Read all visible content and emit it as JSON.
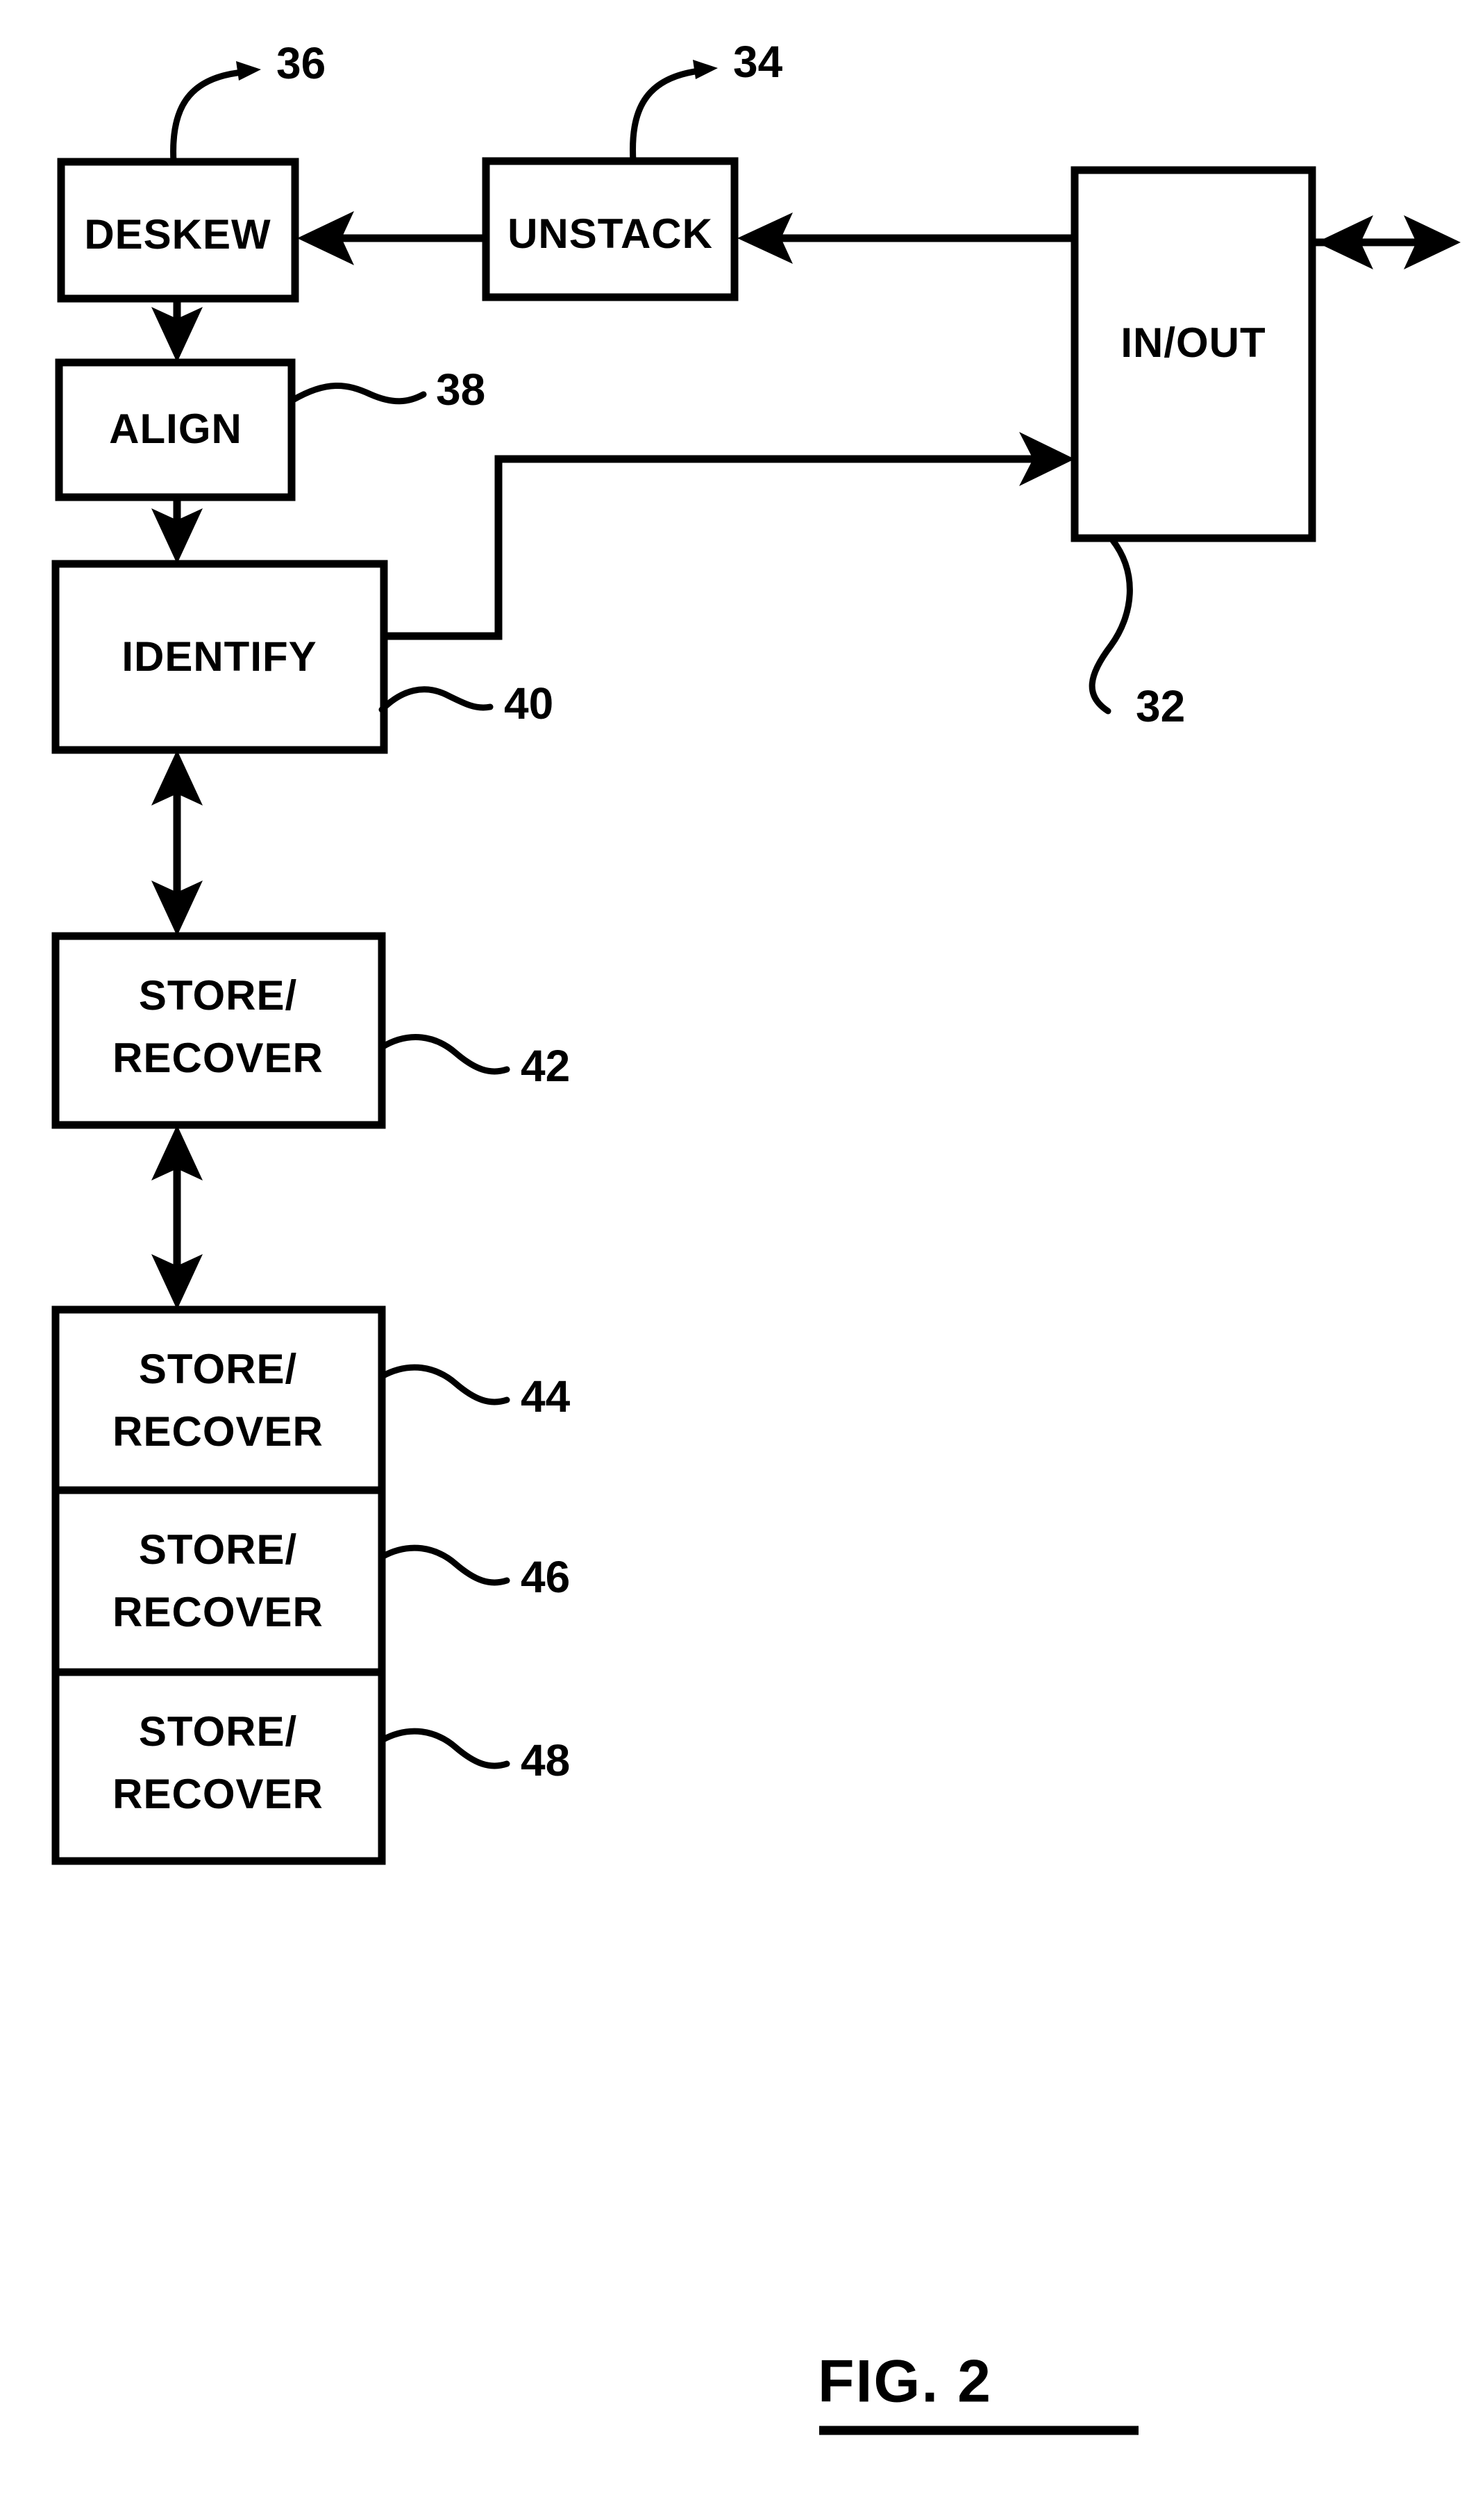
{
  "figure": {
    "caption": "FIG.  2",
    "title": "FIG. 2",
    "line_color": "#000000",
    "background_color": "#ffffff"
  },
  "blocks": [
    {
      "id": "deskew",
      "label": "DESKEW",
      "ref": "36"
    },
    {
      "id": "unstack",
      "label": "UNSTACK",
      "ref": "34"
    },
    {
      "id": "inout",
      "label": "IN/OUT",
      "ref": "32"
    },
    {
      "id": "align",
      "label": "ALIGN",
      "ref": "38"
    },
    {
      "id": "identify",
      "label": "IDENTIFY",
      "ref": "40"
    },
    {
      "id": "store1",
      "label_line1": "STORE/",
      "label_line2": "RECOVER",
      "ref": "42"
    },
    {
      "id": "store2",
      "label_line1": "STORE/",
      "label_line2": "RECOVER",
      "ref": "44"
    },
    {
      "id": "store3",
      "label_line1": "STORE/",
      "label_line2": "RECOVER",
      "ref": "46"
    },
    {
      "id": "store4",
      "label_line1": "STORE/",
      "label_line2": "RECOVER",
      "ref": "48"
    }
  ],
  "connections": [
    {
      "from": "inout",
      "to": "unstack",
      "type": "single-arrow",
      "direction": "left"
    },
    {
      "from": "unstack",
      "to": "deskew",
      "type": "single-arrow",
      "direction": "left"
    },
    {
      "from": "deskew",
      "to": "align",
      "type": "single-arrow",
      "direction": "down"
    },
    {
      "from": "align",
      "to": "identify",
      "type": "single-arrow",
      "direction": "down"
    },
    {
      "from": "identify",
      "to": "inout",
      "type": "single-arrow",
      "direction": "stepped-right"
    },
    {
      "from": "identify",
      "to": "store1",
      "type": "double-arrow",
      "direction": "vertical"
    },
    {
      "from": "store1",
      "to": "store2",
      "type": "double-arrow",
      "direction": "vertical"
    },
    {
      "from": "store2",
      "to": "store3",
      "type": "double-arrow",
      "direction": "vertical"
    },
    {
      "from": "store3",
      "to": "store4",
      "type": "double-arrow",
      "direction": "vertical"
    },
    {
      "from": "inout",
      "to": "external",
      "type": "double-arrow",
      "direction": "horizontal"
    }
  ]
}
